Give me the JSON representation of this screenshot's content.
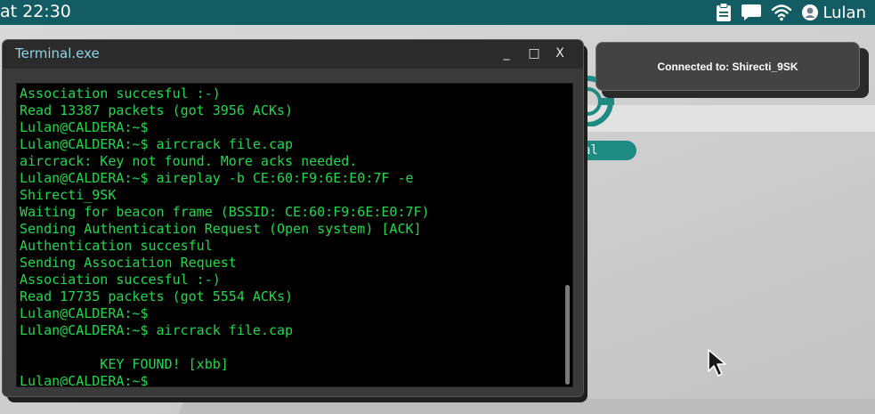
{
  "topbar": {
    "clock": "at 22:30",
    "user_name": "Lulan",
    "icons": [
      "clipboard-icon",
      "chat-icon",
      "wifi-icon",
      "user-icon"
    ]
  },
  "notification": {
    "text": "Connected to: Shirecti_9SK"
  },
  "desktop_icon": {
    "label": "al"
  },
  "terminal": {
    "title": "Terminal.exe",
    "buttons": {
      "minimize": "_",
      "maximize": "□",
      "close": "X"
    },
    "lines": [
      "Association succesful :-)",
      "Read 13387 packets (got 3956 ACKs)",
      "Lulan@CALDERA:~$",
      "Lulan@CALDERA:~$ aircrack file.cap",
      "aircrack: Key not found. More acks needed.",
      "Lulan@CALDERA:~$ aireplay -b CE:60:F9:6E:E0:7F -e",
      "Shirecti_9SK",
      "Waiting for beacon frame (BSSID: CE:60:F9:6E:E0:7F)",
      "Sending Authentication Request (Open system) [ACK]",
      "Authentication succesful",
      "Sending Association Request",
      "Association succesful :-)",
      "Read 17735 packets (got 5554 ACKs)",
      "Lulan@CALDERA:~$",
      "Lulan@CALDERA:~$ aircrack file.cap",
      "",
      "          KEY FOUND! [xbb]",
      "Lulan@CALDERA:~$"
    ]
  },
  "colors": {
    "topbar": "#145c63",
    "terminal_text": "#22d84a",
    "title_text": "#8ed3e6",
    "desktop_accent": "#1e8a82"
  }
}
